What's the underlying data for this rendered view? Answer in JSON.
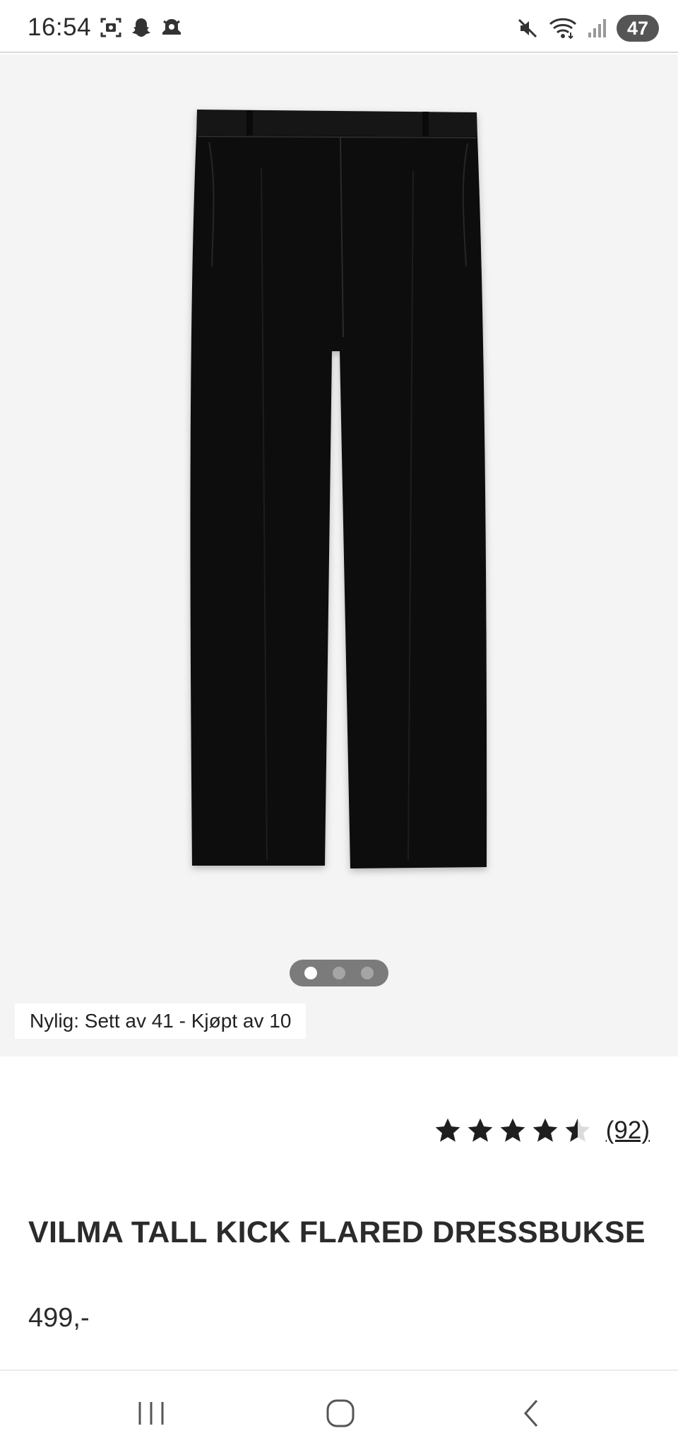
{
  "status_bar": {
    "time": "16:54",
    "battery": "47",
    "left_icons": [
      "screenshot-icon",
      "snapchat-icon",
      "notification-icon"
    ],
    "right_icons": [
      "mute-icon",
      "wifi-icon",
      "signal-icon"
    ]
  },
  "gallery": {
    "image": "black-flared-trousers",
    "pages": 3,
    "active_page": 1,
    "recent_activity": "Nylig: Sett av 41 - Kjøpt av 10"
  },
  "product": {
    "rating": 4.5,
    "rating_max": 5,
    "review_count": "(92)",
    "title": "VILMA TALL KICK FLARED DRESSBUKSE",
    "price": "499,-"
  },
  "colors": {
    "star": "#1f1f1f",
    "star_empty": "#dcdcdc",
    "gallery_bg": "#f4f4f4",
    "text": "#2b2b2b"
  },
  "nav_bar": {
    "buttons": [
      "recent-apps-icon",
      "home-icon",
      "back-icon"
    ]
  }
}
